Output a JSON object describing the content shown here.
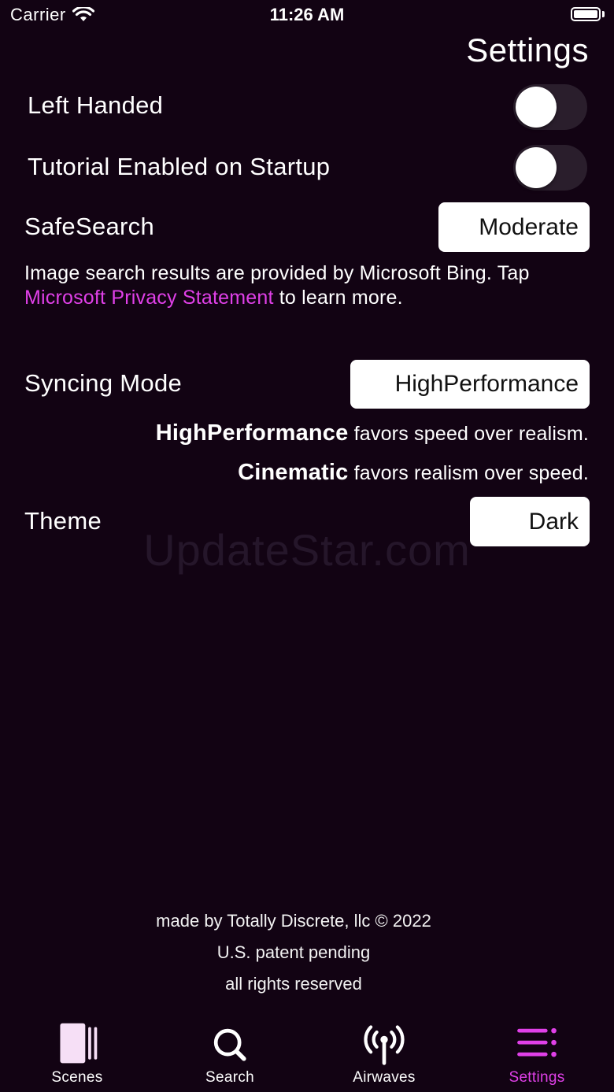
{
  "status_bar": {
    "carrier": "Carrier",
    "time": "11:26 AM"
  },
  "title": "Settings",
  "settings": {
    "left_handed": {
      "label": "Left Handed",
      "on": false
    },
    "tutorial": {
      "label": "Tutorial Enabled on Startup",
      "on": false
    },
    "safesearch": {
      "label": "SafeSearch",
      "value": "Moderate"
    },
    "info": {
      "prefix": "Image search results are provided by Microsoft Bing. Tap ",
      "link": "Microsoft Privacy Statement",
      "suffix": " to learn more."
    },
    "syncing_mode": {
      "label": "Syncing Mode",
      "value": "HighPerformance",
      "desc1_bold": "HighPerformance",
      "desc1_text": " favors speed over realism.",
      "desc2_bold": "Cinematic",
      "desc2_text": " favors realism over speed."
    },
    "theme": {
      "label": "Theme",
      "value": "Dark"
    }
  },
  "watermark": "UpdateStar.com",
  "footer": {
    "line1": "made by Totally Discrete, llc © 2022",
    "line2": "U.S. patent pending",
    "line3": "all rights reserved"
  },
  "tabs": [
    {
      "label": "Scenes",
      "icon": "scenes-icon"
    },
    {
      "label": "Search",
      "icon": "search-icon"
    },
    {
      "label": "Airwaves",
      "icon": "airwaves-icon"
    },
    {
      "label": "Settings",
      "icon": "settings-icon",
      "active": true
    }
  ],
  "colors": {
    "background": "#120313",
    "accent": "#e040e8",
    "toggle_off": "#2a1e2c"
  }
}
